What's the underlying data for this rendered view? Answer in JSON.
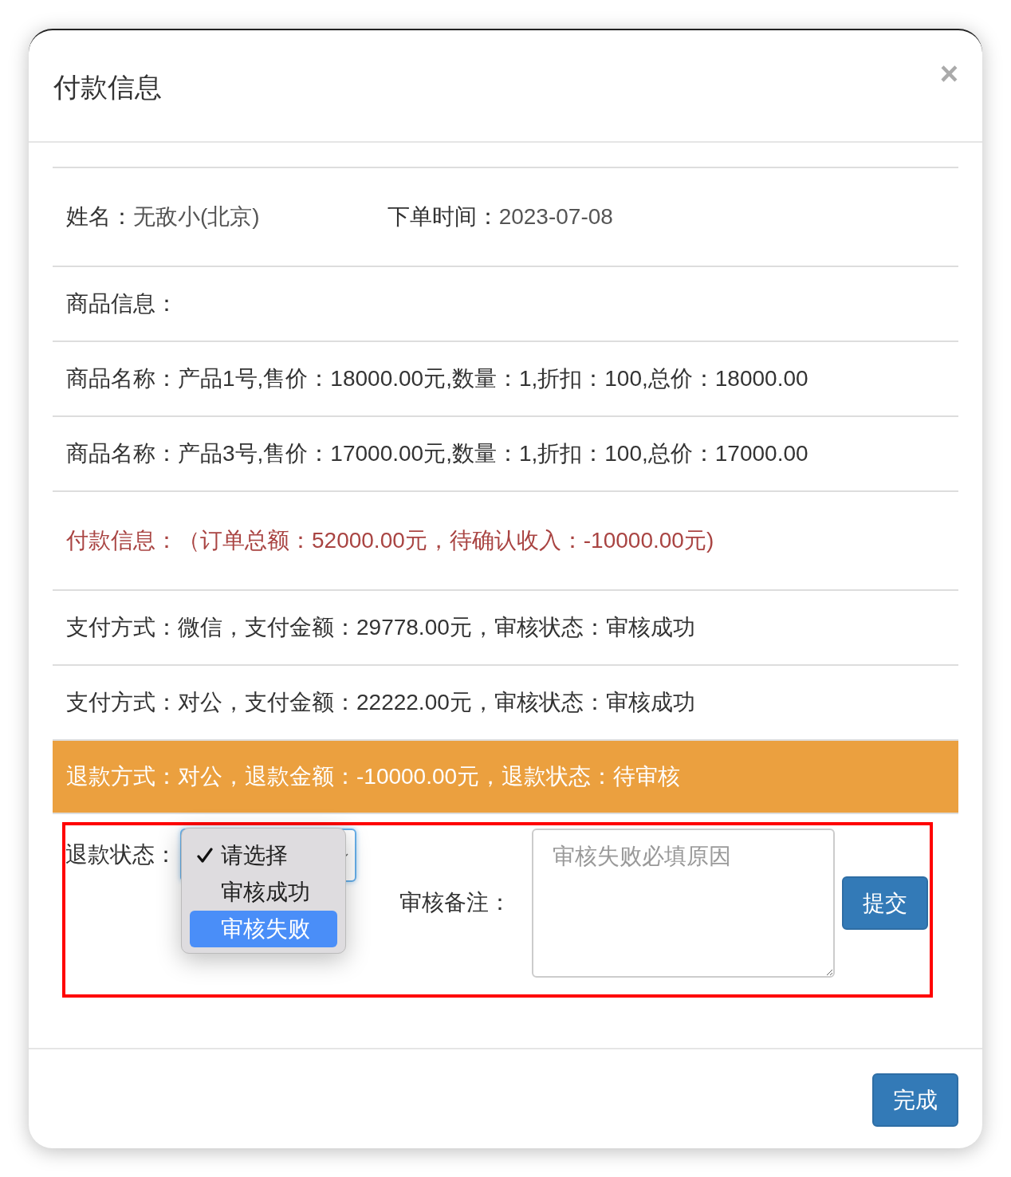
{
  "dialog": {
    "title": "付款信息",
    "close": "×"
  },
  "customer": {
    "label": "姓名：",
    "value": "无敌小(北京)"
  },
  "order_time": {
    "label": "下单时间：",
    "value": "2023-07-08"
  },
  "goods_heading": "商品信息：",
  "goods": [
    "商品名称：产品1号,售价：18000.00元,数量：1,折扣：100,总价：18000.00",
    "商品名称：产品3号,售价：17000.00元,数量：1,折扣：100,总价：17000.00"
  ],
  "payment_summary": "付款信息：（订单总额：52000.00元，待确认收入：-10000.00元)",
  "records": [
    {
      "kind": "payment",
      "text": "支付方式：微信，支付金额：29778.00元，审核状态：审核成功"
    },
    {
      "kind": "payment",
      "text": "支付方式：对公，支付金额：22222.00元，审核状态：审核成功"
    },
    {
      "kind": "refund",
      "text": "退款方式：对公，退款金额：-10000.00元，退款状态：待审核"
    }
  ],
  "review": {
    "highlighted": true,
    "status_label": "退款状态：",
    "options": [
      {
        "label": "请选择",
        "checked": true,
        "selected": false
      },
      {
        "label": "审核成功",
        "checked": false,
        "selected": false
      },
      {
        "label": "审核失败",
        "checked": false,
        "selected": true
      }
    ],
    "remark_label": "审核备注：",
    "remark_placeholder": "审核失败必填原因",
    "submit": "提交"
  },
  "footer": {
    "done": "完成"
  }
}
